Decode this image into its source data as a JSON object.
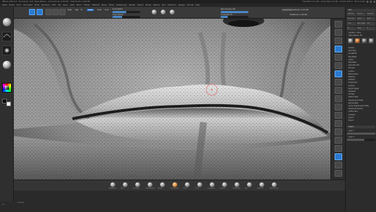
{
  "window": {
    "title": "ZBrush 2021.6.5 · Document · Tool: Head_Retopo · Active Points: 4.219 Mil · Total Points: 4.219 Mil",
    "info": "Free Mem 12.2 GB · Active Mem 4.9 GB · Scratch Disk 0 · Timer 0.001"
  },
  "menu": [
    "Alpha",
    "Brush",
    "Color",
    "Document",
    "Draw",
    "Dynamics",
    "Edit",
    "File",
    "Layer",
    "Light",
    "Macro",
    "Marker",
    "Material",
    "Movie",
    "Picker",
    "Preferences",
    "Render",
    "Stencil",
    "Stroke",
    "Texture",
    "Tool",
    "Transform",
    "Zplugin",
    "Zscript",
    "Help"
  ],
  "shelf": {
    "modes": [
      "Edit",
      "Draw",
      "Move",
      "Scale",
      "Rotate"
    ],
    "mrgb": "Mrgb",
    "rgb": "Rgb",
    "m": "M",
    "zadd": "Zadd",
    "zsub": "Zsub",
    "zcut": "Zcut",
    "focal_label": "Focal Shift 0",
    "draw_size_label": "Draw Size 64",
    "rgb_intensity_label": "Rgb Intensity 100",
    "z_intensity_label": "Z Intensity 25",
    "dynamic": "Dynamic",
    "active_points": "ActivePoints: 4.219 Mil",
    "total_points": "TotalPoints: 4.219 Mil",
    "draw_size": 0.35,
    "z_intensity": 0.25,
    "rgb_intensity": 1.0
  },
  "left_tray": {
    "brushes": [
      "standard-brush",
      "spray-stroke",
      "alpha-off",
      "material-basic"
    ],
    "color": {
      "primary": "#0a0a0a",
      "secondary": "#f0f0f0"
    }
  },
  "right_strip": {
    "buttons": [
      "BPR",
      "SPix 3",
      "Scroll",
      "Zoom",
      "Actual",
      "AAHalf",
      "Persp",
      "Floor",
      "Local",
      "LSym",
      "Xpose",
      "Frame",
      "Move",
      "Scale",
      "Rotate",
      "PolyF",
      "Transp",
      "Ghost",
      "Solo"
    ],
    "active": [
      3,
      6,
      16
    ]
  },
  "palette": {
    "header": "Tool",
    "buttons": [
      "Load Tool",
      "Save As",
      "Copy Tool",
      "Paste Tool",
      "Import",
      "Export",
      "Clone",
      "Make PolyMesh3D",
      "GoZ",
      "All",
      "Visible",
      "R"
    ],
    "lightbox_label": "Lightbox › Tools",
    "tool_name": "Head_Retopo. 48",
    "subpalettes": [
      "SubTool",
      "Geometry",
      "ArrayMesh",
      "NanoMesh",
      "Layers",
      "FiberMesh",
      "Geometry HD",
      "Preview",
      "Surface",
      "Deformation",
      "Masking",
      "Visibility",
      "Polygroups",
      "Contact",
      "Morph Target",
      "Polypaint",
      "UV Map",
      "Texture Map",
      "Displacement Map",
      "Normal Map",
      "Vector Displacement Map",
      "Display Properties",
      "Unified Skin",
      "Initialize",
      "Import",
      "Export"
    ],
    "layers_header": "Layers",
    "layers": [
      "Layer 1",
      "Layer 2"
    ],
    "layer_values": [
      1.0,
      0.6
    ]
  },
  "bottom_shelf": {
    "items": [
      "ClayBuildup",
      "Move",
      "Standard",
      "DamStandard",
      "hPolish",
      "TrimDynamic",
      "Inflate",
      "Pinch",
      "SnakeHook",
      "Smooth",
      "SkinShade4",
      "Dots",
      "Alpha Off",
      "MatCap Gray"
    ],
    "highlight_index": 5
  },
  "status": {
    "timeline": "Timeline"
  },
  "bottom_left": {
    "label": "2T"
  },
  "colors": {
    "accent": "#2a7ad1",
    "panel": "#2c2c2c",
    "shelf": "#3a3a3a"
  }
}
